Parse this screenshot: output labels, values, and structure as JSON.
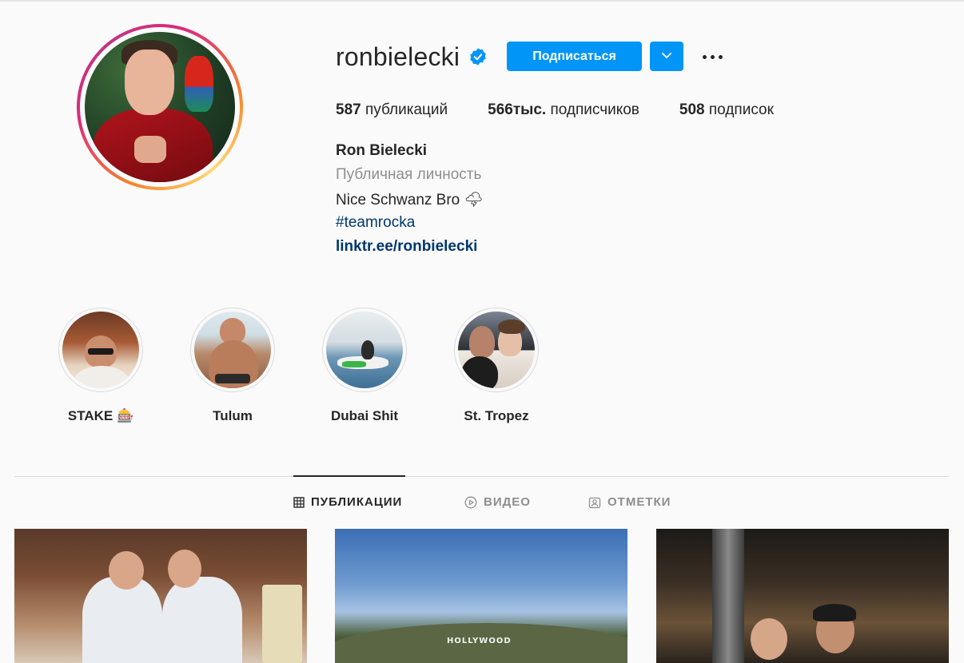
{
  "profile": {
    "username": "ronbielecki",
    "verified": true,
    "follow_label": "Подписаться",
    "stats": {
      "posts_count": "587",
      "posts_label": "публикаций",
      "followers_count": "566тыс.",
      "followers_label": "подписчиков",
      "following_count": "508",
      "following_label": "подписок"
    },
    "full_name": "Ron Bielecki",
    "category": "Публичная личность",
    "bio": "Nice Schwanz Bro 🌩",
    "hashtag": "#teamrocka",
    "link": "linktr.ee/ronbielecki"
  },
  "highlights": [
    {
      "label": "STAKE 🎰"
    },
    {
      "label": "Tulum"
    },
    {
      "label": "Dubai Shit"
    },
    {
      "label": "St. Tropez"
    }
  ],
  "tabs": [
    {
      "label": "ПУБЛИКАЦИИ",
      "icon": "grid-icon",
      "active": true
    },
    {
      "label": "ВИДЕО",
      "icon": "play-icon",
      "active": false
    },
    {
      "label": "ОТМЕТКИ",
      "icon": "tagged-user-icon",
      "active": false
    }
  ],
  "posts": [
    {
      "sign_text": ""
    },
    {
      "sign_text": "HOLLYWOOD"
    },
    {
      "sign_text": ""
    }
  ],
  "colors": {
    "accent": "#0095f6",
    "link": "#00376b",
    "text": "#262626",
    "muted": "#8e8e8e",
    "background": "#fafafa"
  }
}
